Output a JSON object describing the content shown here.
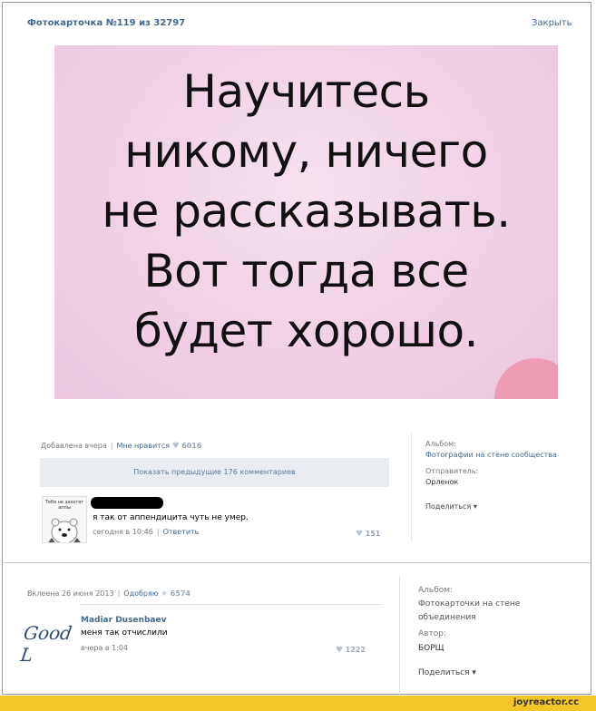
{
  "header": {
    "title": "Фотокарточка №119 из 32797",
    "close": "Закрыть"
  },
  "photo_text": {
    "lines": [
      "Научитесь",
      "никому, ничего",
      "не рассказывать.",
      "Вот тогда все",
      "будет хорошо."
    ]
  },
  "post1": {
    "added": "Добавлена вчера",
    "likes_label": "Мне нравится",
    "likes_count": "6016",
    "show_prev": "Показать предыдущие 176 комментариев",
    "avatar_caption": "Тебя не захотят аппы",
    "comment": "я так от аппендицита чуть не умер.",
    "meta_time": "сегодня в 10:46",
    "reply": "Ответить",
    "comment_likes": "151",
    "album_label": "Альбом:",
    "album_value": "Фотографии на стене сообщества",
    "sender_label": "Отправитель:",
    "sender_value": "Орленок",
    "share": "Поделиться"
  },
  "post2": {
    "added": "Вклеена 26 июня 2013",
    "approve": "Одобряю",
    "approve_count": "6574",
    "author_name": "Madiar Dusenbaev",
    "comment": "меня так отчислили",
    "meta_time": "вчера в 1:04",
    "comment_likes": "1222",
    "avatar_text": "Good L",
    "album_label": "Альбом:",
    "album_value": "Фотокарточки на стене объединения",
    "author_label": "Автор:",
    "author_value": "БОРЩ",
    "share": "Поделиться"
  },
  "footer": {
    "site": "joyreactor.cc"
  },
  "colors": {
    "link": "#45688e",
    "footer_bg": "#f4c526",
    "photo_bg": "#f0cfe4"
  }
}
